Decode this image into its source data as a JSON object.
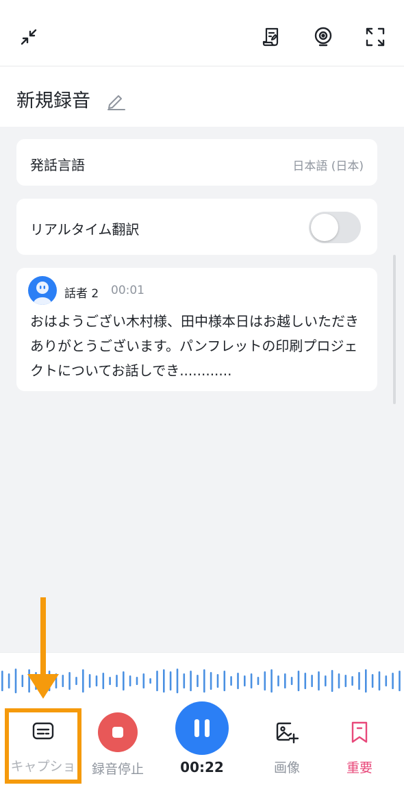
{
  "header": {
    "title": "新規録音"
  },
  "settings": {
    "language_label": "発話言語",
    "language_value": "日本語 (日本)",
    "realtime_translation_label": "リアルタイム翻訳",
    "realtime_translation_on": false
  },
  "transcript": {
    "speaker": "話者 2",
    "timestamp": "00:01",
    "text": "おはようござい木村様、田中様本日はお越しいただきありがとうございます。パンフレットの印刷プロジェクトについてお話しでき............"
  },
  "controls": {
    "caption_label": "キャプショ",
    "stop_label": "録音停止",
    "elapsed": "00:22",
    "image_label": "画像",
    "important_label": "重要"
  },
  "colors": {
    "accent": "#2b7ff5",
    "stop": "#e85858",
    "important": "#e8487a",
    "annotation": "#f59a0c"
  },
  "icons": [
    "collapse-icon",
    "transcript-doc-icon",
    "broadcast-icon",
    "expand-icon",
    "edit-icon",
    "caption-icon",
    "stop-icon",
    "pause-icon",
    "image-add-icon",
    "bookmark-icon"
  ]
}
